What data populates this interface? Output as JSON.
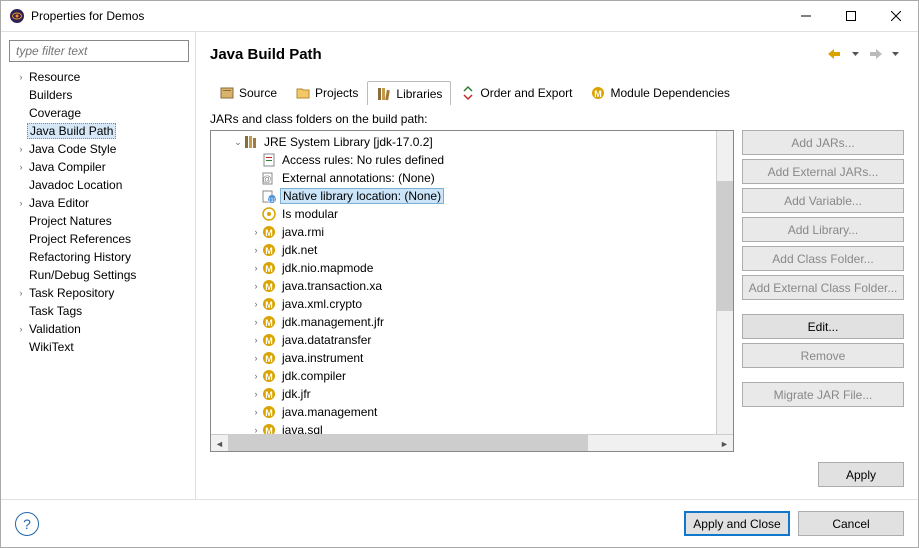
{
  "window": {
    "title": "Properties for Demos"
  },
  "sidebar": {
    "filter_placeholder": "type filter text",
    "items": [
      {
        "label": "Resource",
        "expandable": true
      },
      {
        "label": "Builders"
      },
      {
        "label": "Coverage"
      },
      {
        "label": "Java Build Path",
        "selected": true
      },
      {
        "label": "Java Code Style",
        "expandable": true
      },
      {
        "label": "Java Compiler",
        "expandable": true
      },
      {
        "label": "Javadoc Location"
      },
      {
        "label": "Java Editor",
        "expandable": true
      },
      {
        "label": "Project Natures"
      },
      {
        "label": "Project References"
      },
      {
        "label": "Refactoring History"
      },
      {
        "label": "Run/Debug Settings"
      },
      {
        "label": "Task Repository",
        "expandable": true
      },
      {
        "label": "Task Tags"
      },
      {
        "label": "Validation",
        "expandable": true
      },
      {
        "label": "WikiText"
      }
    ]
  },
  "main": {
    "title": "Java Build Path",
    "tabs": [
      {
        "icon": "source",
        "label": "Source"
      },
      {
        "icon": "folder",
        "label": "Projects"
      },
      {
        "icon": "library",
        "label": "Libraries",
        "active": true
      },
      {
        "icon": "order",
        "label": "Order and Export"
      },
      {
        "icon": "module",
        "label": "Module Dependencies"
      }
    ],
    "panel_header": "JARs and class folders on the build path:",
    "tree_root": {
      "label": "JRE System Library [jdk-17.0.2]"
    },
    "tree_props": [
      {
        "icon": "rules",
        "label": "Access rules: No rules defined"
      },
      {
        "icon": "anno",
        "label": "External annotations: (None)"
      },
      {
        "icon": "native",
        "label": "Native library location: (None)",
        "selected": true
      },
      {
        "icon": "modular",
        "label": "Is modular"
      }
    ],
    "tree_mods": [
      "java.rmi",
      "jdk.net",
      "jdk.nio.mapmode",
      "java.transaction.xa",
      "java.xml.crypto",
      "jdk.management.jfr",
      "java.datatransfer",
      "java.instrument",
      "jdk.compiler",
      "jdk.jfr",
      "java.management",
      "java.sql"
    ],
    "buttons": [
      {
        "label": "Add JARs...",
        "disabled": true
      },
      {
        "label": "Add External JARs...",
        "disabled": true
      },
      {
        "label": "Add Variable...",
        "disabled": true
      },
      {
        "label": "Add Library...",
        "disabled": true
      },
      {
        "label": "Add Class Folder...",
        "disabled": true
      },
      {
        "label": "Add External Class Folder...",
        "disabled": true
      },
      {
        "gap": true
      },
      {
        "label": "Edit..."
      },
      {
        "label": "Remove",
        "disabled": true
      },
      {
        "gap": true
      },
      {
        "label": "Migrate JAR File...",
        "disabled": true
      }
    ],
    "apply_label": "Apply"
  },
  "footer": {
    "apply_close": "Apply and Close",
    "cancel": "Cancel"
  }
}
